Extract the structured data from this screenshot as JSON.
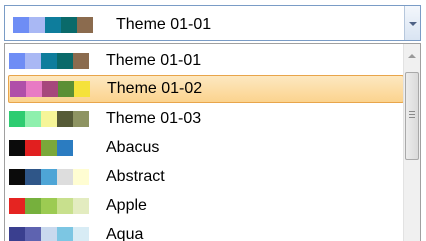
{
  "combo": {
    "selected_label": "Theme 01-01",
    "selected_swatches": [
      "#6e8df5",
      "#a9b8f4",
      "#0e7d9c",
      "#0a6a6a",
      "#8b6b4e"
    ]
  },
  "dropdown": {
    "items": [
      {
        "label": "Theme 01-01",
        "swatches": [
          "#6e8df5",
          "#a9b8f4",
          "#0e7d9c",
          "#0a6a6a",
          "#8b6b4e"
        ]
      },
      {
        "label": "Theme 01-02",
        "swatches": [
          "#b04fa9",
          "#e87ac4",
          "#a6477c",
          "#5b8f34",
          "#f5e23a"
        ],
        "selected": true
      },
      {
        "label": "Theme 01-03",
        "swatches": [
          "#2ecc71",
          "#8ef0ad",
          "#f6f598",
          "#565b37",
          "#8e9462"
        ]
      },
      {
        "label": "Abacus",
        "swatches": [
          "#0b0b0b",
          "#e11f1f",
          "#7aa83a",
          "#2b7cc1"
        ]
      },
      {
        "label": "Abstract",
        "swatches": [
          "#0b0b0b",
          "#2f5688",
          "#4ea5d6",
          "#dddddd",
          "#fffdd2"
        ]
      },
      {
        "label": "Apple",
        "swatches": [
          "#e52421",
          "#76b03d",
          "#9ccb52",
          "#c8e08d",
          "#e3ecc0"
        ]
      },
      {
        "label": "Aqua",
        "swatches": [
          "#3a3f8f",
          "#5e63b0",
          "#c9d9ee",
          "#7cc6e3",
          "#d8ecf5"
        ]
      }
    ]
  },
  "colors": {
    "selection_border": "#e8a54b",
    "selection_fill": "#fbd38e",
    "combo_border": "#7a9cc6"
  }
}
